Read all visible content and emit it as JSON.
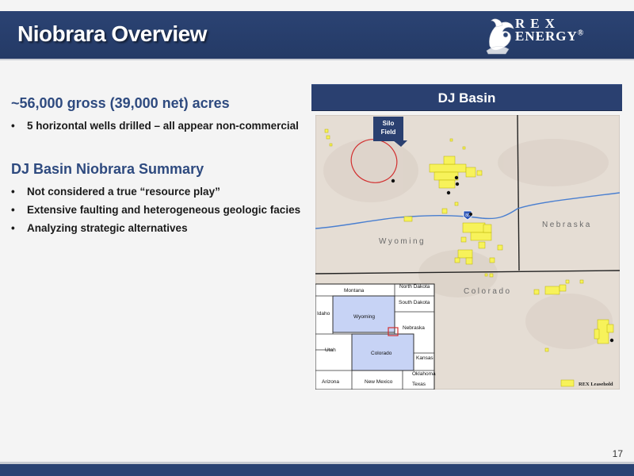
{
  "slide": {
    "title": "Niobrara Overview",
    "page_number": "17",
    "colors": {
      "header_bar": "#2b4373",
      "heading_text": "#2e4a7f",
      "leasehold": "#f7f25a",
      "map_highlight": "#c7d3f5"
    }
  },
  "logo": {
    "line1": "REX",
    "line2": "ENERGY",
    "mark": "®"
  },
  "acreage": {
    "heading": "~56,000 gross (39,000 net) acres",
    "bullets": [
      "5 horizontal wells drilled – all appear non-commercial"
    ]
  },
  "summary": {
    "heading": "DJ Basin Niobrara Summary",
    "bullets": [
      "Not considered a true “resource play”",
      "Extensive faulting and heterogeneous geologic facies",
      "Analyzing strategic alternatives"
    ]
  },
  "map": {
    "title": "DJ Basin",
    "callout": [
      "Silo",
      "Field"
    ],
    "state_labels": {
      "wyoming": "Wyoming",
      "nebraska": "Nebraska",
      "colorado": "Colorado"
    },
    "highway": "80",
    "legend": "REX Leasehold",
    "inset_states": [
      "Montana",
      "North Dakota",
      "South Dakota",
      "Idaho",
      "Wyoming",
      "Nebraska",
      "Utah",
      "Colorado",
      "Kansas",
      "Oklahoma",
      "Arizona",
      "New Mexico",
      "Texas"
    ]
  }
}
